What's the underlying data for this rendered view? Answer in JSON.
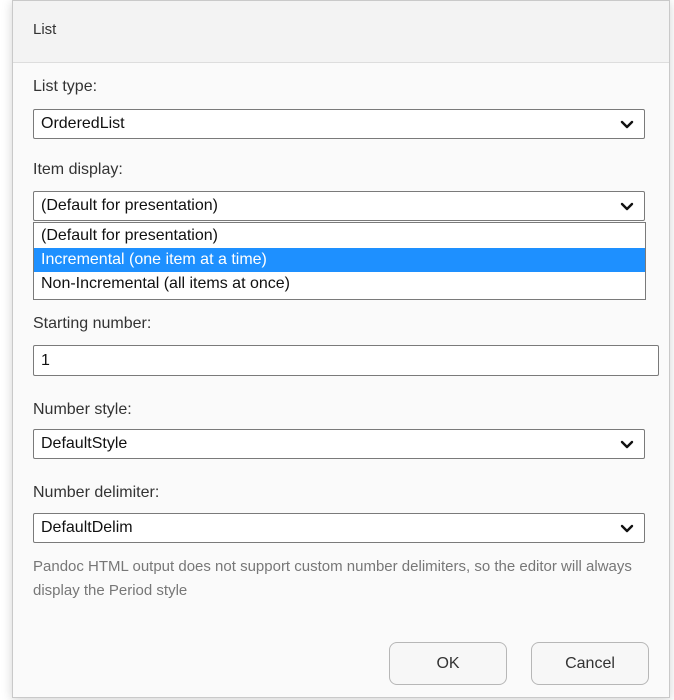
{
  "dialog": {
    "title": "List"
  },
  "list_type": {
    "label": "List type:",
    "value": "OrderedList"
  },
  "item_display": {
    "label": "Item display:",
    "value": "(Default for presentation)",
    "options": [
      {
        "label": "(Default for presentation)",
        "selected": false
      },
      {
        "label": "Incremental (one item at a time)",
        "selected": true
      },
      {
        "label": "Non-Incremental (all items at once)",
        "selected": false
      }
    ]
  },
  "starting_number": {
    "label": "Starting number:",
    "value": "1"
  },
  "number_style": {
    "label": "Number style:",
    "value": "DefaultStyle"
  },
  "number_delimiter": {
    "label": "Number delimiter:",
    "value": "DefaultDelim",
    "note": "Pandoc HTML output does not support custom number delimiters, so the editor will always display the Period style"
  },
  "buttons": {
    "ok": "OK",
    "cancel": "Cancel"
  },
  "colors": {
    "selection": "#1e90ff",
    "note_text": "#777777"
  }
}
